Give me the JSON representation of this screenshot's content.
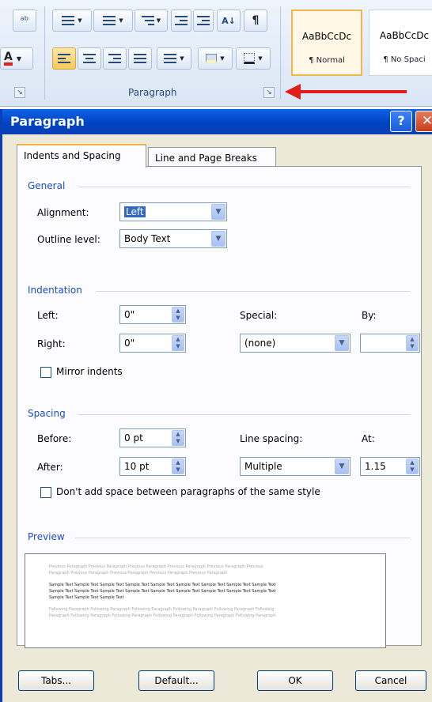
{
  "ribbon": {
    "group_label": "Paragraph",
    "launcher_glyph": "↘",
    "styles": [
      {
        "sample": "AaBbCcDc",
        "name": "¶ Normal"
      },
      {
        "sample": "AaBbCcDc",
        "name": "¶ No Spaci"
      }
    ],
    "icons": [
      "spelling-icon",
      "bullets-icon",
      "numbering-icon",
      "multilevel-list-icon",
      "decrease-indent-icon",
      "increase-indent-icon",
      "sort-icon",
      "show-marks-icon",
      "font-color-icon",
      "align-left-icon",
      "center-icon",
      "align-right-icon",
      "justify-icon",
      "line-spacing-icon",
      "shading-icon",
      "borders-icon"
    ],
    "glyphs": {
      "sort": "A↓",
      "marks": "¶",
      "font_color": "A",
      "abc": "ᵃᵇ"
    }
  },
  "dialog": {
    "title": "Paragraph",
    "help": "?",
    "close": "✕",
    "tabs": [
      "Indents and Spacing",
      "Line and Page Breaks"
    ],
    "general": {
      "heading": "General",
      "alignment_label": "Alignment:",
      "alignment_value": "Left",
      "outline_label": "Outline level:",
      "outline_value": "Body Text"
    },
    "indentation": {
      "heading": "Indentation",
      "left_label": "Left:",
      "left_value": "0\"",
      "right_label": "Right:",
      "right_value": "0\"",
      "special_label": "Special:",
      "special_value": "(none)",
      "by_label": "By:",
      "by_value": "",
      "mirror_label": "Mirror indents"
    },
    "spacing": {
      "heading": "Spacing",
      "before_label": "Before:",
      "before_value": "0 pt",
      "after_label": "After:",
      "after_value": "10 pt",
      "line_spacing_label": "Line spacing:",
      "line_spacing_value": "Multiple",
      "at_label": "At:",
      "at_value": "1.15",
      "dont_add_label": "Don't add space between paragraphs of the same style"
    },
    "preview": {
      "heading": "Preview",
      "prev_line1": "Previous Paragraph Previous Paragraph Previous Paragraph Previous Paragraph Previous Paragraph Previous",
      "prev_line2": "Paragraph Previous Paragraph Previous Paragraph Previous Paragraph Previous Paragraph",
      "sample_line1": "Sample Text Sample Text Sample Text Sample Text Sample Text Sample Text Sample Text Sample Text Sample Text",
      "sample_line2": "Sample Text Sample Text Sample Text Sample Text Sample Text Sample Text Sample Text Sample Text Sample Text",
      "sample_line3": "Sample Text Sample Text Sample Text",
      "follow_line1": "Following Paragraph Following Paragraph Following Paragraph Following Paragraph Following Paragraph Following",
      "follow_line2": "Paragraph Following Paragraph Following Paragraph Following Paragraph Following Paragraph Following Paragraph"
    },
    "buttons": {
      "tabs": "Tabs...",
      "default": "Default...",
      "ok": "OK",
      "cancel": "Cancel"
    }
  },
  "colors": {
    "accent_arrow": "#e31c1c",
    "titlebar": "#0043c4",
    "selection": "#316ac5"
  }
}
